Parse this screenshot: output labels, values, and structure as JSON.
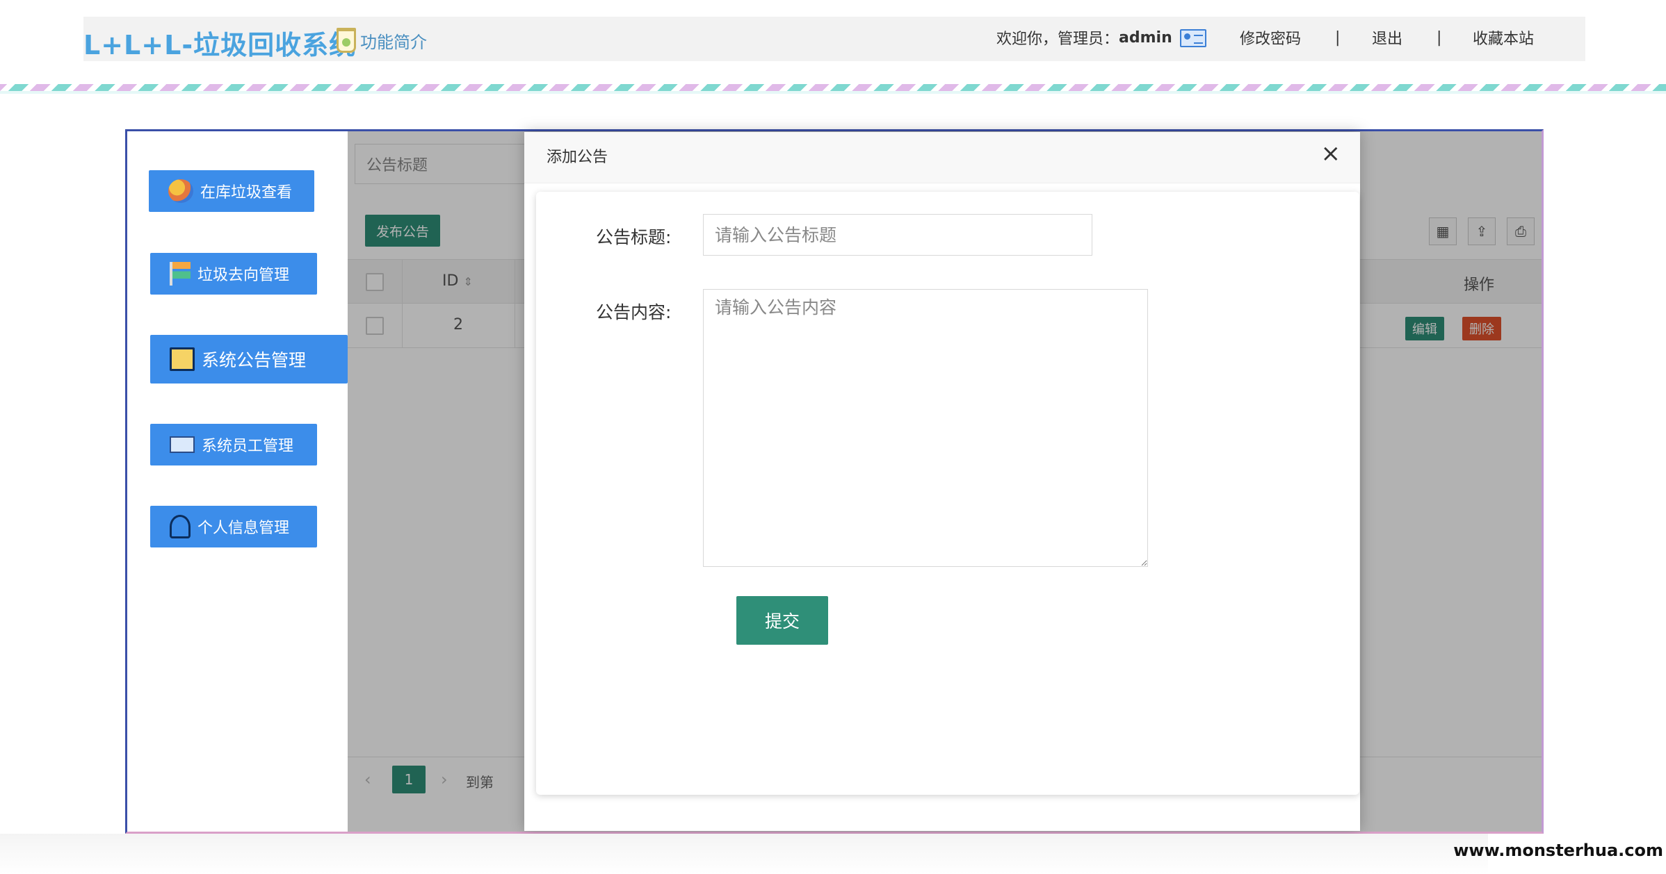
{
  "header": {
    "brand": "L+L+L-垃圾回收系统",
    "intro": "功能简介",
    "welcome_prefix": "欢迎你，管理员：",
    "username": "admin",
    "change_password": "修改密码",
    "separator": "|",
    "logout": "退出",
    "favorite": "收藏本站"
  },
  "sidebar": {
    "items": [
      {
        "label": "在库垃圾查看",
        "icon": "globe-icon"
      },
      {
        "label": "垃圾去向管理",
        "icon": "signpost-icon"
      },
      {
        "label": "系统公告管理",
        "icon": "folder-image-icon"
      },
      {
        "label": "系统员工管理",
        "icon": "id-card-icon"
      },
      {
        "label": "个人信息管理",
        "icon": "person-icon"
      }
    ]
  },
  "content": {
    "search_placeholder": "公告标题",
    "publish_button": "发布公告",
    "table": {
      "headers": {
        "id": "ID",
        "actions": "操作"
      },
      "rows": [
        {
          "id": "2",
          "edit": "编辑",
          "delete": "删除"
        }
      ]
    },
    "pager": {
      "prev": "‹",
      "page": "1",
      "next": "›",
      "goto": "到第"
    }
  },
  "modal": {
    "title": "添加公告",
    "close": "×",
    "title_label": "公告标题:",
    "title_placeholder": "请输入公告标题",
    "content_label": "公告内容:",
    "content_placeholder": "请输入公告内容",
    "submit": "提交"
  },
  "watermark": "www.monsterhua.com"
}
